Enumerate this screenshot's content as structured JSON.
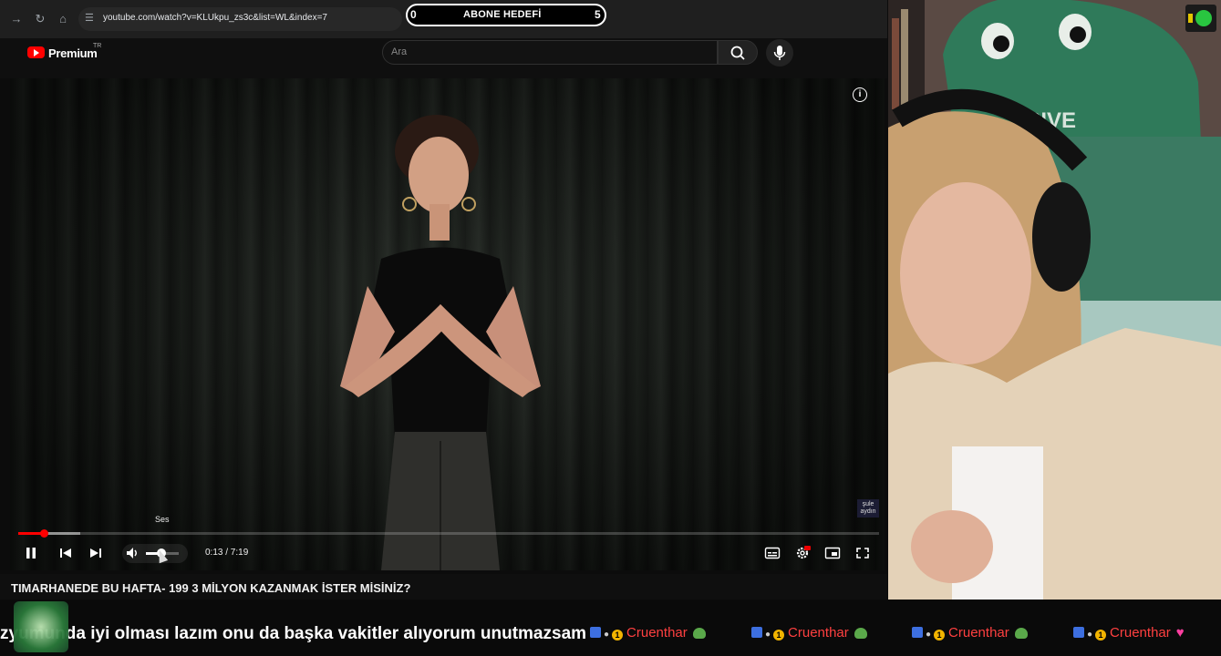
{
  "browser": {
    "back_icon": "arrow-right-icon",
    "reload_icon": "reload-icon",
    "home_icon": "home-icon",
    "url": "youtube.com/watch?v=KLUkpu_zs3c&list=WL&index=7"
  },
  "goal": {
    "left": "0",
    "title": "ABONE HEDEFİ",
    "right": "5"
  },
  "youtube": {
    "brand": "Premium",
    "region": "TR",
    "search_placeholder": "Ara",
    "accent": "#ff0000"
  },
  "player": {
    "volume_tooltip": "Ses",
    "time": "0:13 / 7:19",
    "progress": 0.03,
    "volume": 0.4,
    "watermark": "şule aydın"
  },
  "video_title": "TIMARHANEDE BU HAFTA- 199 3 MİLYON KAZANMAK İSTER MİSİNİZ?",
  "ticker": {
    "message": "zyumunda iyi olması lazım onu da başka vakitler alıyorum unutmazsam",
    "coin_value": "1",
    "tags": [
      {
        "name": "Cruenthar",
        "emote": "frog"
      },
      {
        "name": "Cruenthar",
        "emote": "frog"
      },
      {
        "name": "Cruenthar",
        "emote": "frog"
      },
      {
        "name": "Cruenthar",
        "emote": "heart"
      }
    ],
    "name_color": "#ff4040"
  }
}
